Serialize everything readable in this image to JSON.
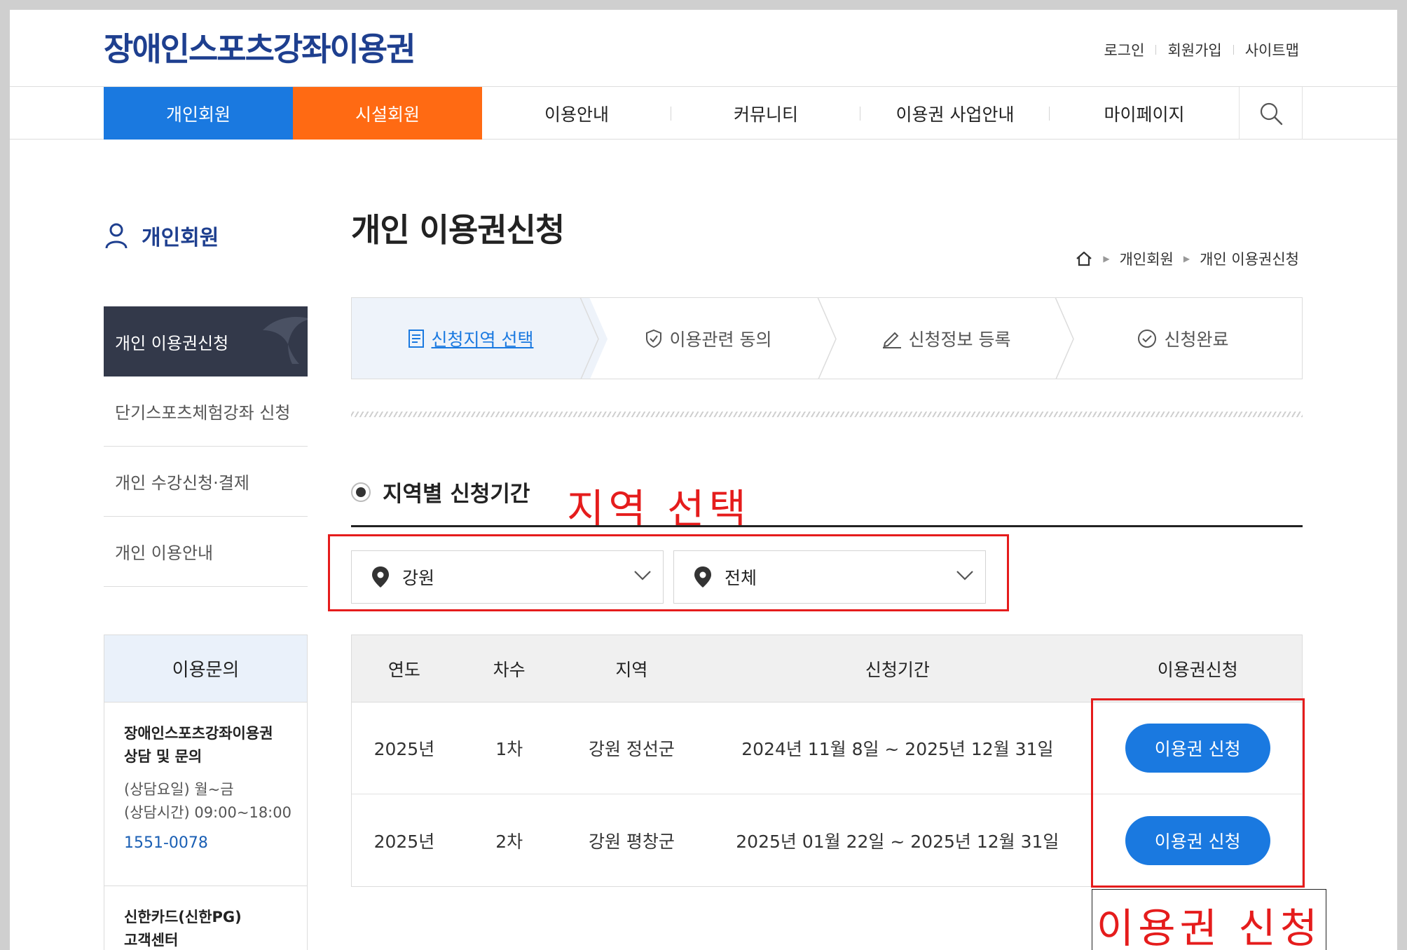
{
  "header": {
    "logo": "장애인스포츠강좌이용권",
    "util_links": [
      "로그인",
      "회원가입",
      "사이트맵"
    ]
  },
  "gnb": {
    "items": [
      "개인회원",
      "시설회원",
      "이용안내",
      "커뮤니티",
      "이용권 사업안내",
      "마이페이지"
    ],
    "search_icon": "search-icon"
  },
  "sidebar": {
    "title": "개인회원",
    "menu": [
      "개인 이용권신청",
      "단기스포츠체험강좌 신청",
      "개인 수강신청·결제",
      "개인 이용안내"
    ],
    "inquiry": {
      "title": "이용문의",
      "block1_title_1": "장애인스포츠강좌이용권",
      "block1_title_2": "상담 및 문의",
      "block1_line1": "(상담요일) 월~금",
      "block1_line2": "(상담시간) 09:00~18:00",
      "block1_tel": "1551-0078",
      "block2_title_1": "신한카드(신한PG)",
      "block2_title_2": "고객센터"
    }
  },
  "main": {
    "title": "개인 이용권신청",
    "breadcrumb": [
      "개인회원",
      "개인 이용권신청"
    ],
    "steps": [
      "신청지역 선택",
      "이용관련 동의",
      "신청정보 등록",
      "신청완료"
    ],
    "section_title": "지역별 신청기간",
    "annotation_region": "지역 선택",
    "select_province": "강원",
    "select_district": "전체",
    "table": {
      "headers": [
        "연도",
        "차수",
        "지역",
        "신청기간",
        "이용권신청"
      ],
      "rows": [
        {
          "year": "2025년",
          "round": "1차",
          "region": "강원 정선군",
          "period": "2024년 11월 8일 ~ 2025년 12월 31일",
          "button": "이용권 신청"
        },
        {
          "year": "2025년",
          "round": "2차",
          "region": "강원 평창군",
          "period": "2025년 01월 22일 ~ 2025년 12월 31일",
          "button": "이용권 신청"
        }
      ]
    },
    "annotation_voucher": "이용권 신청"
  },
  "colors": {
    "brand_blue": "#1a79e0",
    "brand_orange": "#ff6a13",
    "logo_navy": "#1e3f8f",
    "sidebar_active": "#33394a",
    "annotation_red": "#e51c1c"
  }
}
